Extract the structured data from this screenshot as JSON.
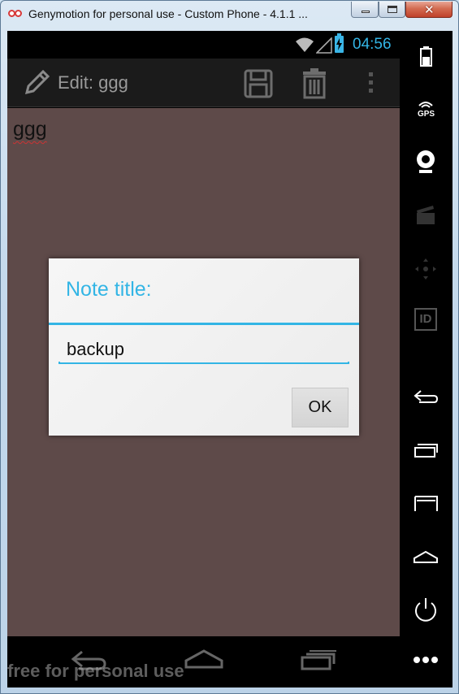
{
  "window": {
    "title": "Genymotion for personal use - Custom Phone - 4.1.1 ...",
    "controls": [
      "minimize",
      "maximize",
      "close"
    ]
  },
  "status_bar": {
    "time": "04:56",
    "icons": [
      "wifi-icon",
      "signal-icon",
      "battery-charging-icon"
    ],
    "accent_color": "#33b5e5"
  },
  "action_bar": {
    "title": "Edit: ggg",
    "icons": [
      "pencil-icon",
      "save-icon",
      "delete-icon",
      "overflow-menu-icon"
    ]
  },
  "note": {
    "text": "ggg"
  },
  "dialog": {
    "title": "Note title:",
    "input_value": "backup",
    "ok_label": "OK",
    "accent_color": "#33b5e5"
  },
  "navigation_bar": {
    "buttons": [
      "back",
      "home",
      "recent-apps"
    ]
  },
  "watermark": "free for personal use",
  "sidebar": {
    "gps_label": "GPS",
    "id_label": "ID",
    "icons": [
      "battery-icon",
      "gps-icon",
      "camera-icon",
      "video-capture-icon",
      "remote-control-icon",
      "device-id-icon",
      "back-icon",
      "recent-apps-icon",
      "menu-icon",
      "home-icon",
      "power-icon",
      "more-icon"
    ]
  }
}
